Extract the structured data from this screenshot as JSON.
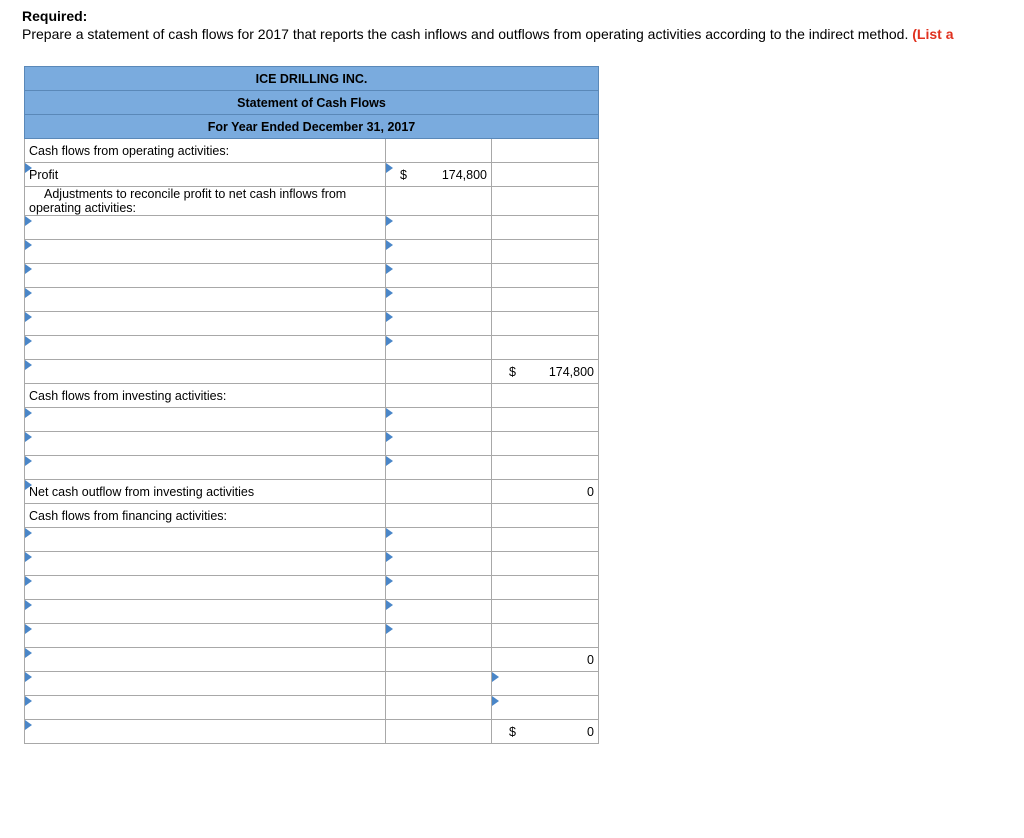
{
  "instructions": {
    "label": "Required:",
    "text": "Prepare a statement of cash flows for 2017 that reports the cash inflows and outflows from operating activities according to the indirect method. ",
    "note": "(List a"
  },
  "statement": {
    "company": "ICE DRILLING INC.",
    "title": "Statement of Cash Flows",
    "period": "For Year Ended December 31, 2017",
    "operating_heading": "Cash flows from operating activities:",
    "profit_label": "Profit",
    "profit_dollar": "$",
    "profit_value": "174,800",
    "adjustments_label": "Adjustments to reconcile profit to net cash inflows from operating activities:",
    "operating_total_dollar": "$",
    "operating_total_value": "174,800",
    "investing_heading": "Cash flows from investing activities:",
    "investing_total_label": "Net cash outflow from investing activities",
    "investing_total_value": "0",
    "financing_heading": "Cash flows from financing activities:",
    "financing_total_value": "0",
    "net_total_dollar": "$",
    "net_total_value": "0"
  }
}
